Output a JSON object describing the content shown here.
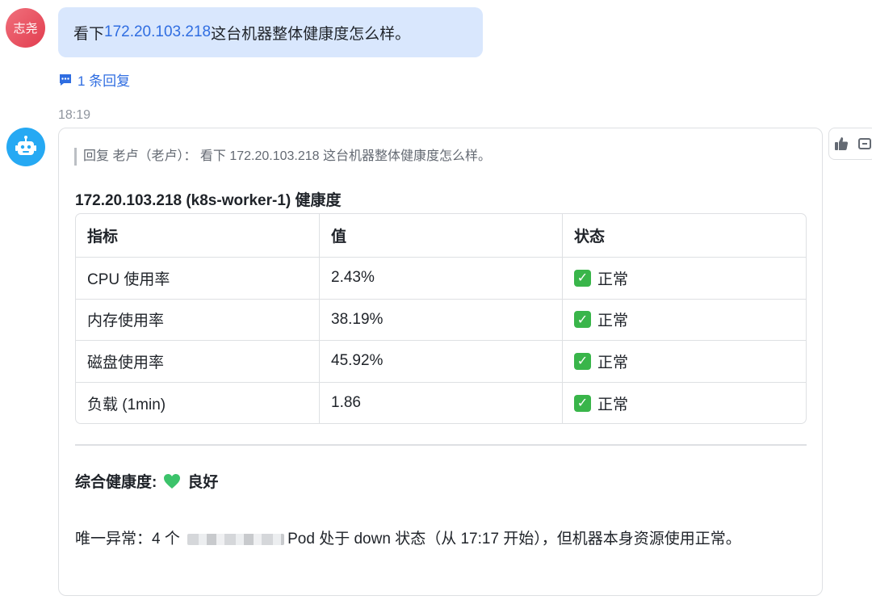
{
  "user_message": {
    "avatar_text": "志尧",
    "prefix": "看下 ",
    "ip": "172.20.103.218",
    "suffix": " 这台机器整体健康度怎么样。",
    "reply_count": "1 条回复"
  },
  "timestamp": "18:19",
  "bot_reply": {
    "quote": "回复 老卢（老卢）： 看下 172.20.103.218 这台机器整体健康度怎么样。",
    "title": "172.20.103.218 (k8s-worker-1) 健康度",
    "table": {
      "headers": [
        "指标",
        "值",
        "状态"
      ],
      "rows": [
        {
          "metric": "CPU 使用率",
          "value": "2.43%",
          "status": "正常"
        },
        {
          "metric": "内存使用率",
          "value": "38.19%",
          "status": "正常"
        },
        {
          "metric": "磁盘使用率",
          "value": "45.92%",
          "status": "正常"
        },
        {
          "metric": "负载 (1min)",
          "value": "1.86",
          "status": "正常"
        }
      ]
    },
    "summary_label": "综合健康度:",
    "summary_value": "良好",
    "note_prefix": "唯一异常：4 个 ",
    "note_suffix": "Pod 处于 down 状态（从 17:17 开始），但机器本身资源使用正常。"
  },
  "colors": {
    "bubble_bg": "#d9e7fd",
    "link": "#2f6de1",
    "bot_avatar": "#26a9f3",
    "ok_check": "#39b54a",
    "heart": "#3cc36b"
  },
  "icons": [
    "reply-thread-icon",
    "robot-icon",
    "check-mark-icon",
    "green-heart-icon",
    "thumbs-up-icon",
    "more-icon"
  ]
}
